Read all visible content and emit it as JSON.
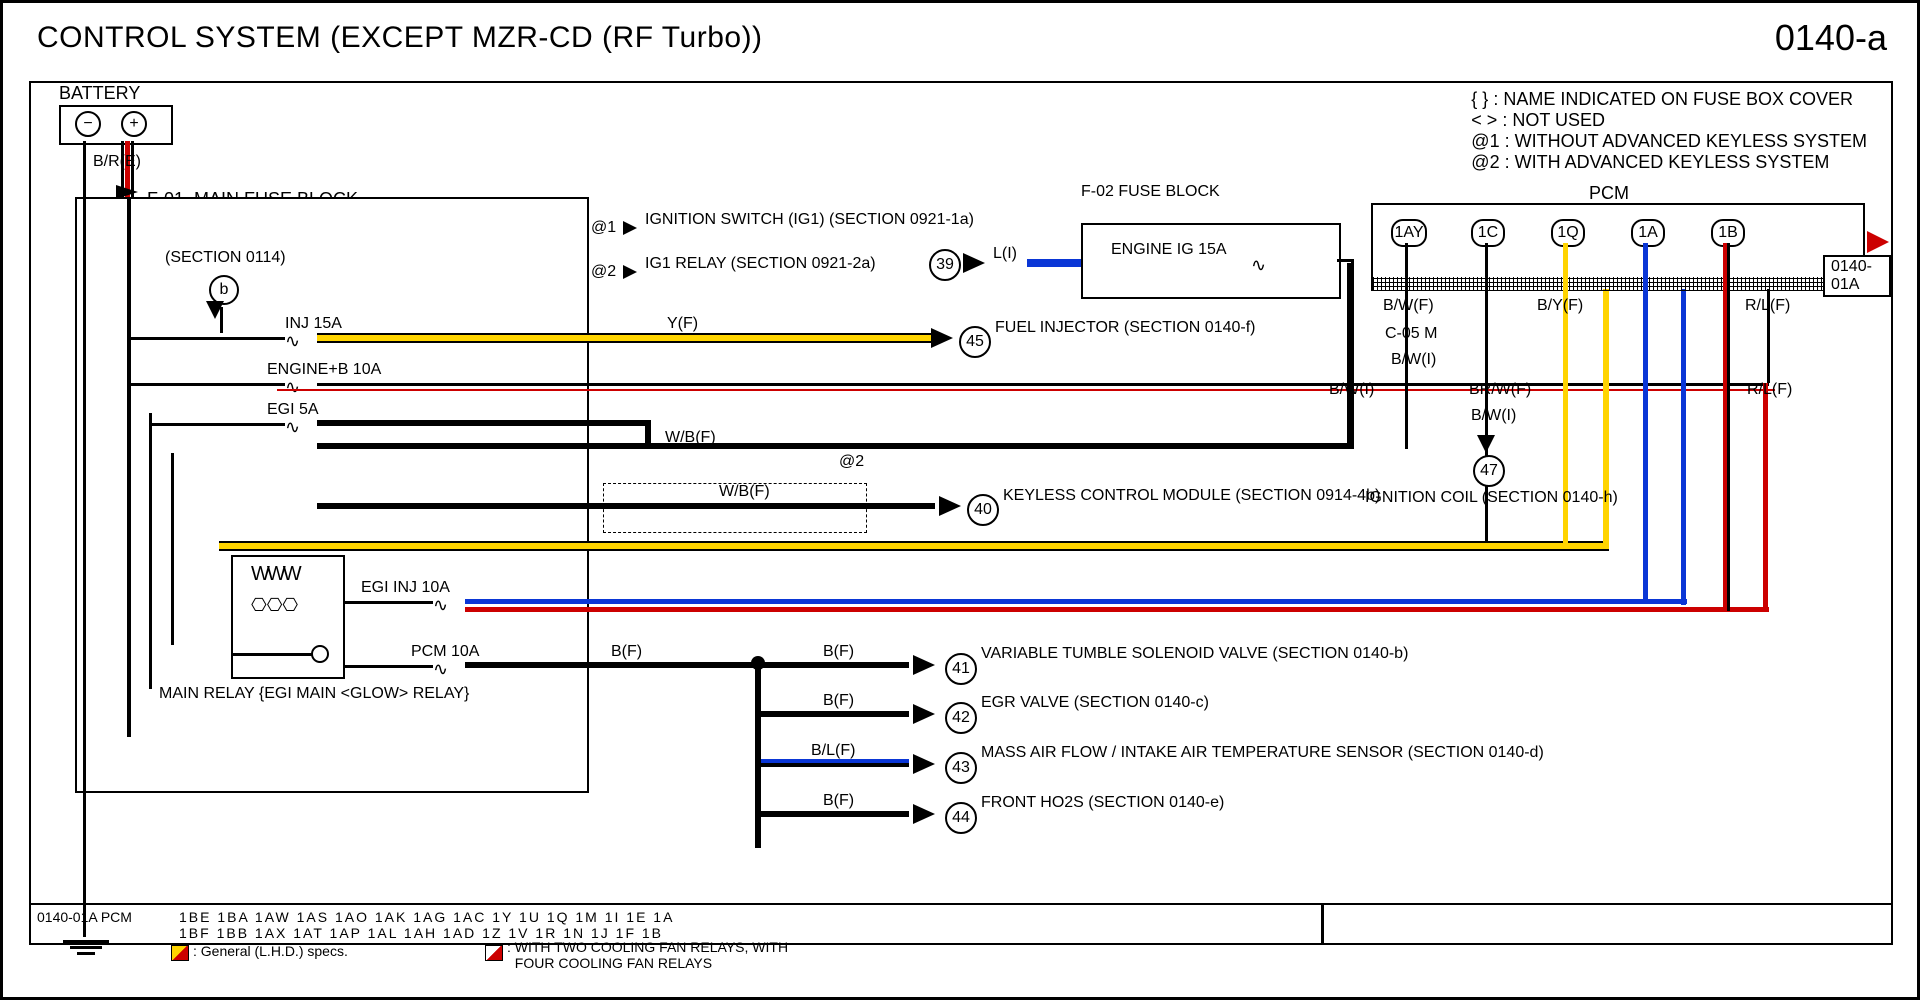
{
  "title": "CONTROL SYSTEM (EXCEPT MZR-CD (RF Turbo))",
  "page_number": "0140-a",
  "legend_notes": [
    "{ } : NAME INDICATED ON FUSE BOX COVER",
    "< > : NOT USED",
    "@1 : WITHOUT ADVANCED KEYLESS SYSTEM",
    "@2 : WITH ADVANCED KEYLESS SYSTEM"
  ],
  "blocks": {
    "battery": "BATTERY",
    "main_fuse": "F-01  MAIN FUSE BLOCK",
    "fuse_block": "F-02\nFUSE BLOCK",
    "fuse_block_fuse": "ENGINE IG 15A",
    "pcm": "PCM",
    "keyless": "KEYLESS CONTROL MODULE\n(SECTION 0914-4b)",
    "main_relay": "MAIN RELAY\n{EGI MAIN\n<GLOW> RELAY}",
    "section_0114": "(SECTION 0114)",
    "b_conn": "b"
  },
  "fuses": {
    "inj": "INJ 15A",
    "engine_b": "ENGINE+B 10A",
    "egi": "EGI 5A",
    "egi_inj": "EGI INJ 10A",
    "pcm10": "PCM 10A"
  },
  "refs": {
    "ign_switch": "IGNITION SWITCH (IG1)\n(SECTION 0921-1a)",
    "ig1_relay": "IG1 RELAY\n(SECTION 0921-2a)",
    "fuel_injector": "FUEL INJECTOR\n(SECTION 0140-f)",
    "ignition_coil": "IGNITION COIL\n(SECTION 0140-h)",
    "vtsv": "VARIABLE TUMBLE SOLENOID VALVE\n(SECTION 0140-b)",
    "egr": "EGR VALVE\n(SECTION 0140-c)",
    "maf": "MASS AIR FLOW / INTAKE AIR TEMPERATURE SENSOR\n(SECTION 0140-d)",
    "ho2s": "FRONT HO2S\n(SECTION 0140-e)"
  },
  "wires": {
    "bre": "B/R(E)",
    "li": "L(I)",
    "yf": "Y(F)",
    "wbf": "W/B(F)",
    "bwf": "B/W(F)",
    "bwi": "B/W(I)",
    "brwf": "BR/W(F)",
    "byf": "B/Y(F)",
    "rlf": "R/L(F)",
    "bf": "B(F)",
    "blf": "B/L(F)",
    "c05m": "C-05     M"
  },
  "terminals": {
    "t39": "39",
    "t40": "40",
    "t41": "41",
    "t42": "42",
    "t43": "43",
    "t44": "44",
    "t45": "45",
    "t47": "47",
    "p1ay": "1AY",
    "p1c": "1C",
    "p1q": "1Q",
    "p1a": "1A",
    "p1b": "1B"
  },
  "at": {
    "a1": "@1",
    "a2": "@2",
    "a2b": "@2"
  },
  "offpage": "0140-01A",
  "footer": {
    "ref": "0140-01A\nPCM",
    "pins_top": "1BE  1BA  1AW  1AS  1AO  1AK  1AG  1AC   1Y    1U    1Q    1M    1I     1E    1A",
    "pins_bot": "1BF  1BB  1AX  1AT  1AP  1AL  1AH  1AD   1Z    1V    1R    1N    1J    1F    1B",
    "general": ": General (L.H.D.) specs.",
    "withfans": ": WITH TWO COOLING FAN RELAYS, WITH\n  FOUR COOLING FAN RELAYS"
  }
}
